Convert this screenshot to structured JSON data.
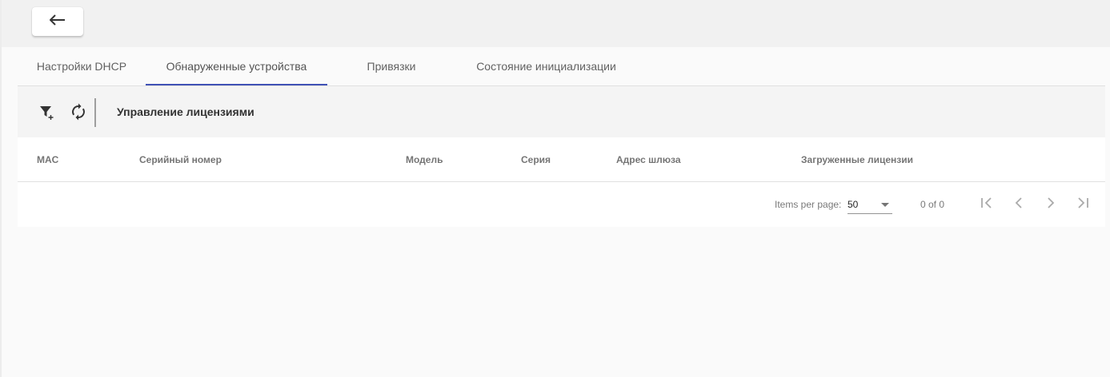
{
  "header": {
    "back_icon": "arrow-left-icon"
  },
  "tabs": [
    {
      "label": "Настройки DHCP",
      "active": false
    },
    {
      "label": "Обнаруженные устройства",
      "active": true
    },
    {
      "label": "Привязки",
      "active": false
    },
    {
      "label": "Состояние инициализации",
      "active": false
    }
  ],
  "toolbar": {
    "filter_icon": "filter-add-icon",
    "refresh_icon": "refresh-icon",
    "title": "Управление лицензиями"
  },
  "table": {
    "columns": [
      "MAC",
      "Серийный номер",
      "Модель",
      "Серия",
      "Адрес шлюза",
      "Загруженные лицензии"
    ],
    "rows": []
  },
  "paginator": {
    "items_per_page_label": "Items per page:",
    "page_size": "50",
    "range_label": "0 of 0"
  },
  "colors": {
    "accent": "#3f51b5",
    "background": "#fafafa",
    "toolbar": "#f4f4f4"
  }
}
